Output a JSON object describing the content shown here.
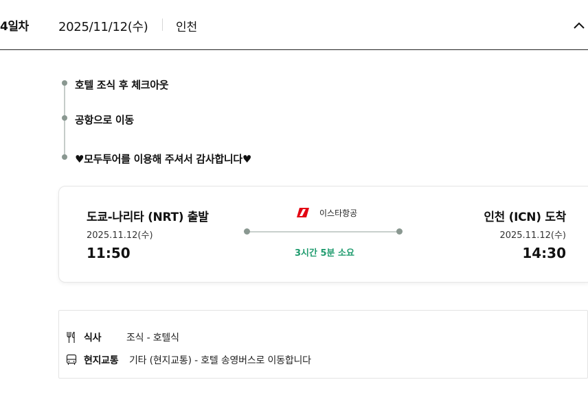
{
  "day": {
    "label": "4일차",
    "date": "2025/11/12(수)",
    "city": "인천",
    "collapse_icon": "chevron-up-icon"
  },
  "schedule": {
    "items": [
      {
        "text": "호텔 조식 후 체크아웃"
      },
      {
        "text": "공항으로 이동"
      },
      {
        "text": "♥모두투어를 이용해 주셔서 감사합니다♥"
      }
    ]
  },
  "flight": {
    "departure": {
      "title": "도쿄-나리타 (NRT) 출발",
      "date": "2025.11.12(수)",
      "time": "11:50"
    },
    "airline": {
      "name": "이스타항공",
      "logo_color": "#e30613"
    },
    "duration": "3시간 5분 소요",
    "duration_color": "#1f9b6e",
    "arrival": {
      "title": "인천 (ICN) 도착",
      "date": "2025.11.12(수)",
      "time": "14:30"
    }
  },
  "info": {
    "meal": {
      "icon": "utensils-icon",
      "label": "식사",
      "value": "조식 - 호텔식"
    },
    "transport": {
      "icon": "bus-icon",
      "label": "현지교통",
      "value": "기타 (현지교통) - 호텔 송영버스로 이동합니다"
    }
  }
}
